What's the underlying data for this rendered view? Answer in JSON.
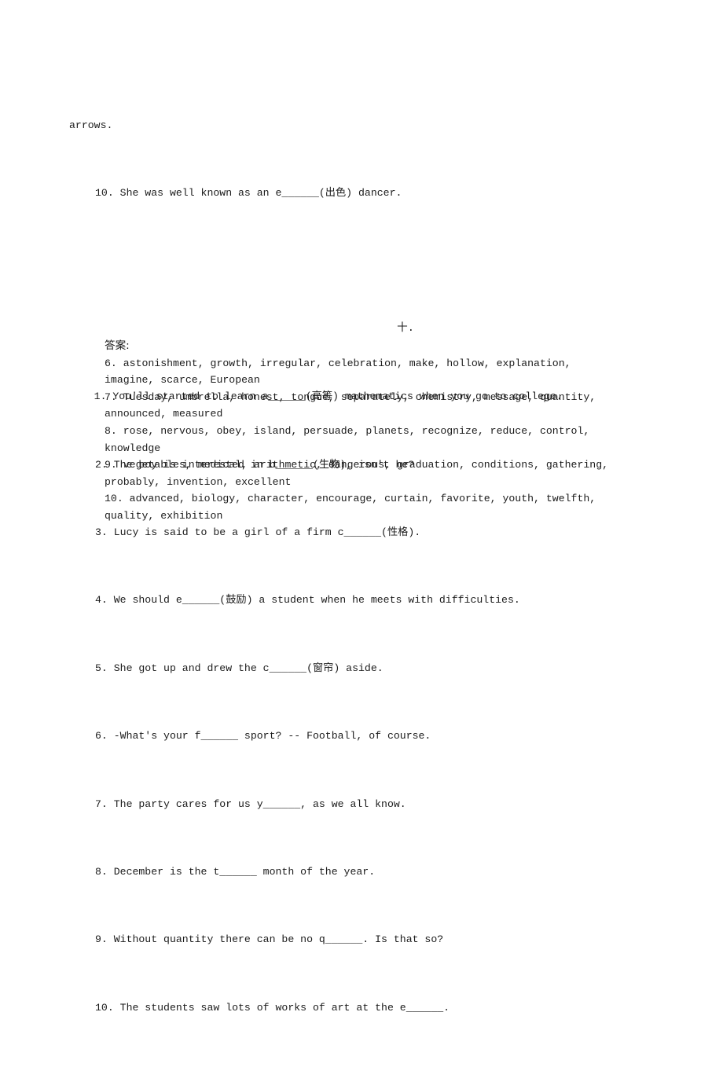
{
  "document": {
    "type": "worksheet",
    "language_mix": "english-chinese",
    "top_fragment": "arrows.",
    "prev_section_last_item": "10. She was well known as an e______(出色) dancer.",
    "section_heading": "十.",
    "questions": [
      {
        "number": "1.",
        "text": "1. You'll started to learn a______(高等) mathematics when you go to college.",
        "line1": "1. You'll started to learn a______(高等) mathematics when you go to",
        "line2": "college.",
        "justified": true
      },
      {
        "number": "2.",
        "text": "2. The boy is interested in b______(生物), isn't he?",
        "justified": false
      },
      {
        "number": "3.",
        "text": "3. Lucy is said to be a girl of a firm c______(性格).",
        "justified": false
      },
      {
        "number": "4.",
        "text": "4. We should e______(鼓励) a student when he meets with difficulties.",
        "justified": false
      },
      {
        "number": "5.",
        "text": "5. She got up and drew the c______(窗帘) aside.",
        "justified": false
      },
      {
        "number": "6.",
        "text": "6. -What's your f______ sport? -- Football, of course.",
        "justified": false
      },
      {
        "number": "7.",
        "text": "7. The party cares for us y______, as we all know.",
        "justified": false
      },
      {
        "number": "8.",
        "text": "8. December is the t______ month of the year.",
        "justified": false
      },
      {
        "number": "9.",
        "text": "9. Without quantity there can be no q______. Is that so?",
        "justified": false
      },
      {
        "number": "10.",
        "text": "10. The students saw lots of works of art at the e______.",
        "justified": false
      }
    ],
    "answers": {
      "header": "答案:",
      "groups": [
        {
          "number": "6.",
          "text": "6. astonishment, growth, irregular, celebration, make, hollow, explanation, imagine, scarce, European",
          "words": [
            "astonishment",
            "growth",
            "irregular",
            "celebration",
            "make",
            "hollow",
            "explanation",
            "imagine",
            "scarce",
            "European"
          ]
        },
        {
          "number": "7.",
          "text": "7. Tuesday, umbrella, honest, tongue, separately, chemistry, message, quantity, announced, measured",
          "words": [
            "Tuesday",
            "umbrella",
            "honest",
            "tongue",
            "separately",
            "chemistry",
            "message",
            "quantity",
            "announced",
            "measured"
          ]
        },
        {
          "number": "8.",
          "text": "8. rose, nervous, obey, island, persuade, planets, recognize, reduce, control, knowledge",
          "words": [
            "rose",
            "nervous",
            "obey",
            "island",
            "persuade",
            "planets",
            "recognize",
            "reduce",
            "control",
            "knowledge"
          ]
        },
        {
          "number": "9.",
          "text": "9. vegetables, medical, arithmetic, dangerous, graduation, conditions, gathering, probably, invention, excellent",
          "words": [
            "vegetables",
            "medical",
            "arithmetic",
            "dangerous",
            "graduation",
            "conditions",
            "gathering",
            "probably",
            "invention",
            "excellent"
          ]
        },
        {
          "number": "10.",
          "text": "10. advanced, biology, character, encourage, curtain, favorite, youth, twelfth, quality, exhibition",
          "words": [
            "advanced",
            "biology",
            "character",
            "encourage",
            "curtain",
            "favorite",
            "youth",
            "twelfth",
            "quality",
            "exhibition"
          ]
        }
      ]
    },
    "colors": {
      "page_background": "#ffffff",
      "text": "#1b1b1b"
    }
  }
}
